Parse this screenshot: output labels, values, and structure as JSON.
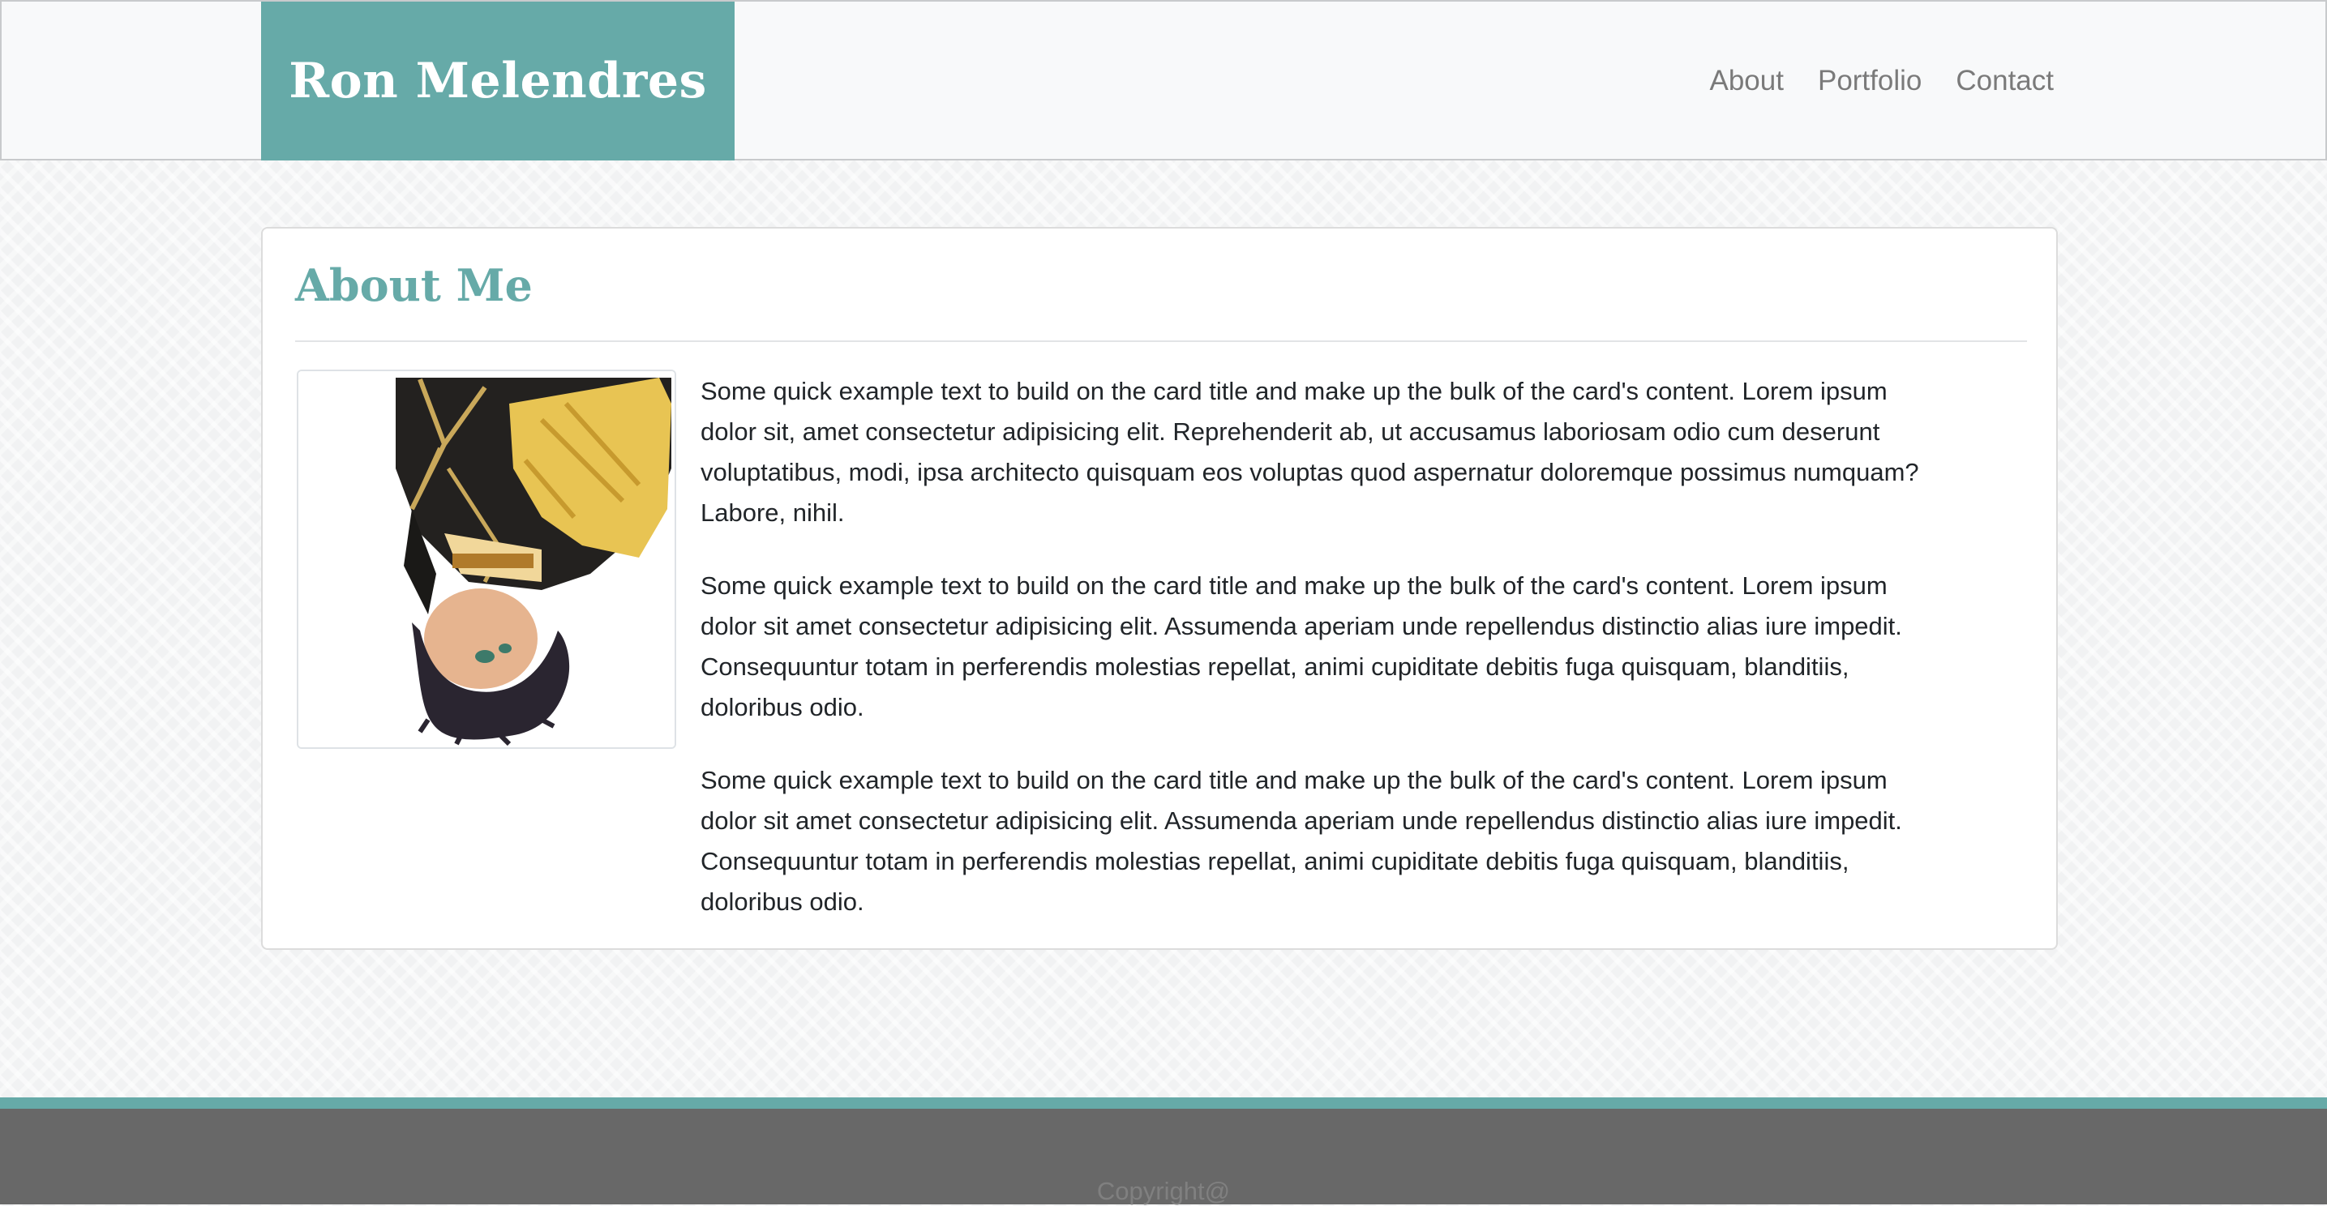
{
  "navbar": {
    "brand": "Ron Melendres",
    "links": [
      "About",
      "Portfolio",
      "Contact"
    ]
  },
  "about": {
    "title": "About Me",
    "paragraphs": [
      "Some quick example text to build on the card title and make up the bulk of the card's content. Lorem ipsum dolor sit, amet consectetur adipisicing elit. Reprehenderit ab, ut accusamus laboriosam odio cum deserunt voluptatibus, modi, ipsa architecto quisquam eos voluptas quod aspernatur doloremque possimus numquam? Labore, nihil.",
      "Some quick example text to build on the card title and make up the bulk of the card's content. Lorem ipsum dolor sit amet consectetur adipisicing elit. Assumenda aperiam unde repellendus distinctio alias iure impedit. Consequuntur totam in perferendis molestias repellat, animi cupiditate debitis fuga quisquam, blanditiis, doloribus odio.",
      "Some quick example text to build on the card title and make up the bulk of the card's content. Lorem ipsum dolor sit amet consectetur adipisicing elit. Assumenda aperiam unde repellendus distinctio alias iure impedit. Consequuntur totam in perferendis molestias repellat, animi cupiditate debitis fuga quisquam, blanditiis, doloribus odio."
    ]
  },
  "footer": {
    "copyright": "Copyright@"
  },
  "colors": {
    "accent": "#66aaa8",
    "navbar_bg": "#f8f9fa",
    "footer_bg": "#686868",
    "text": "#212529"
  }
}
